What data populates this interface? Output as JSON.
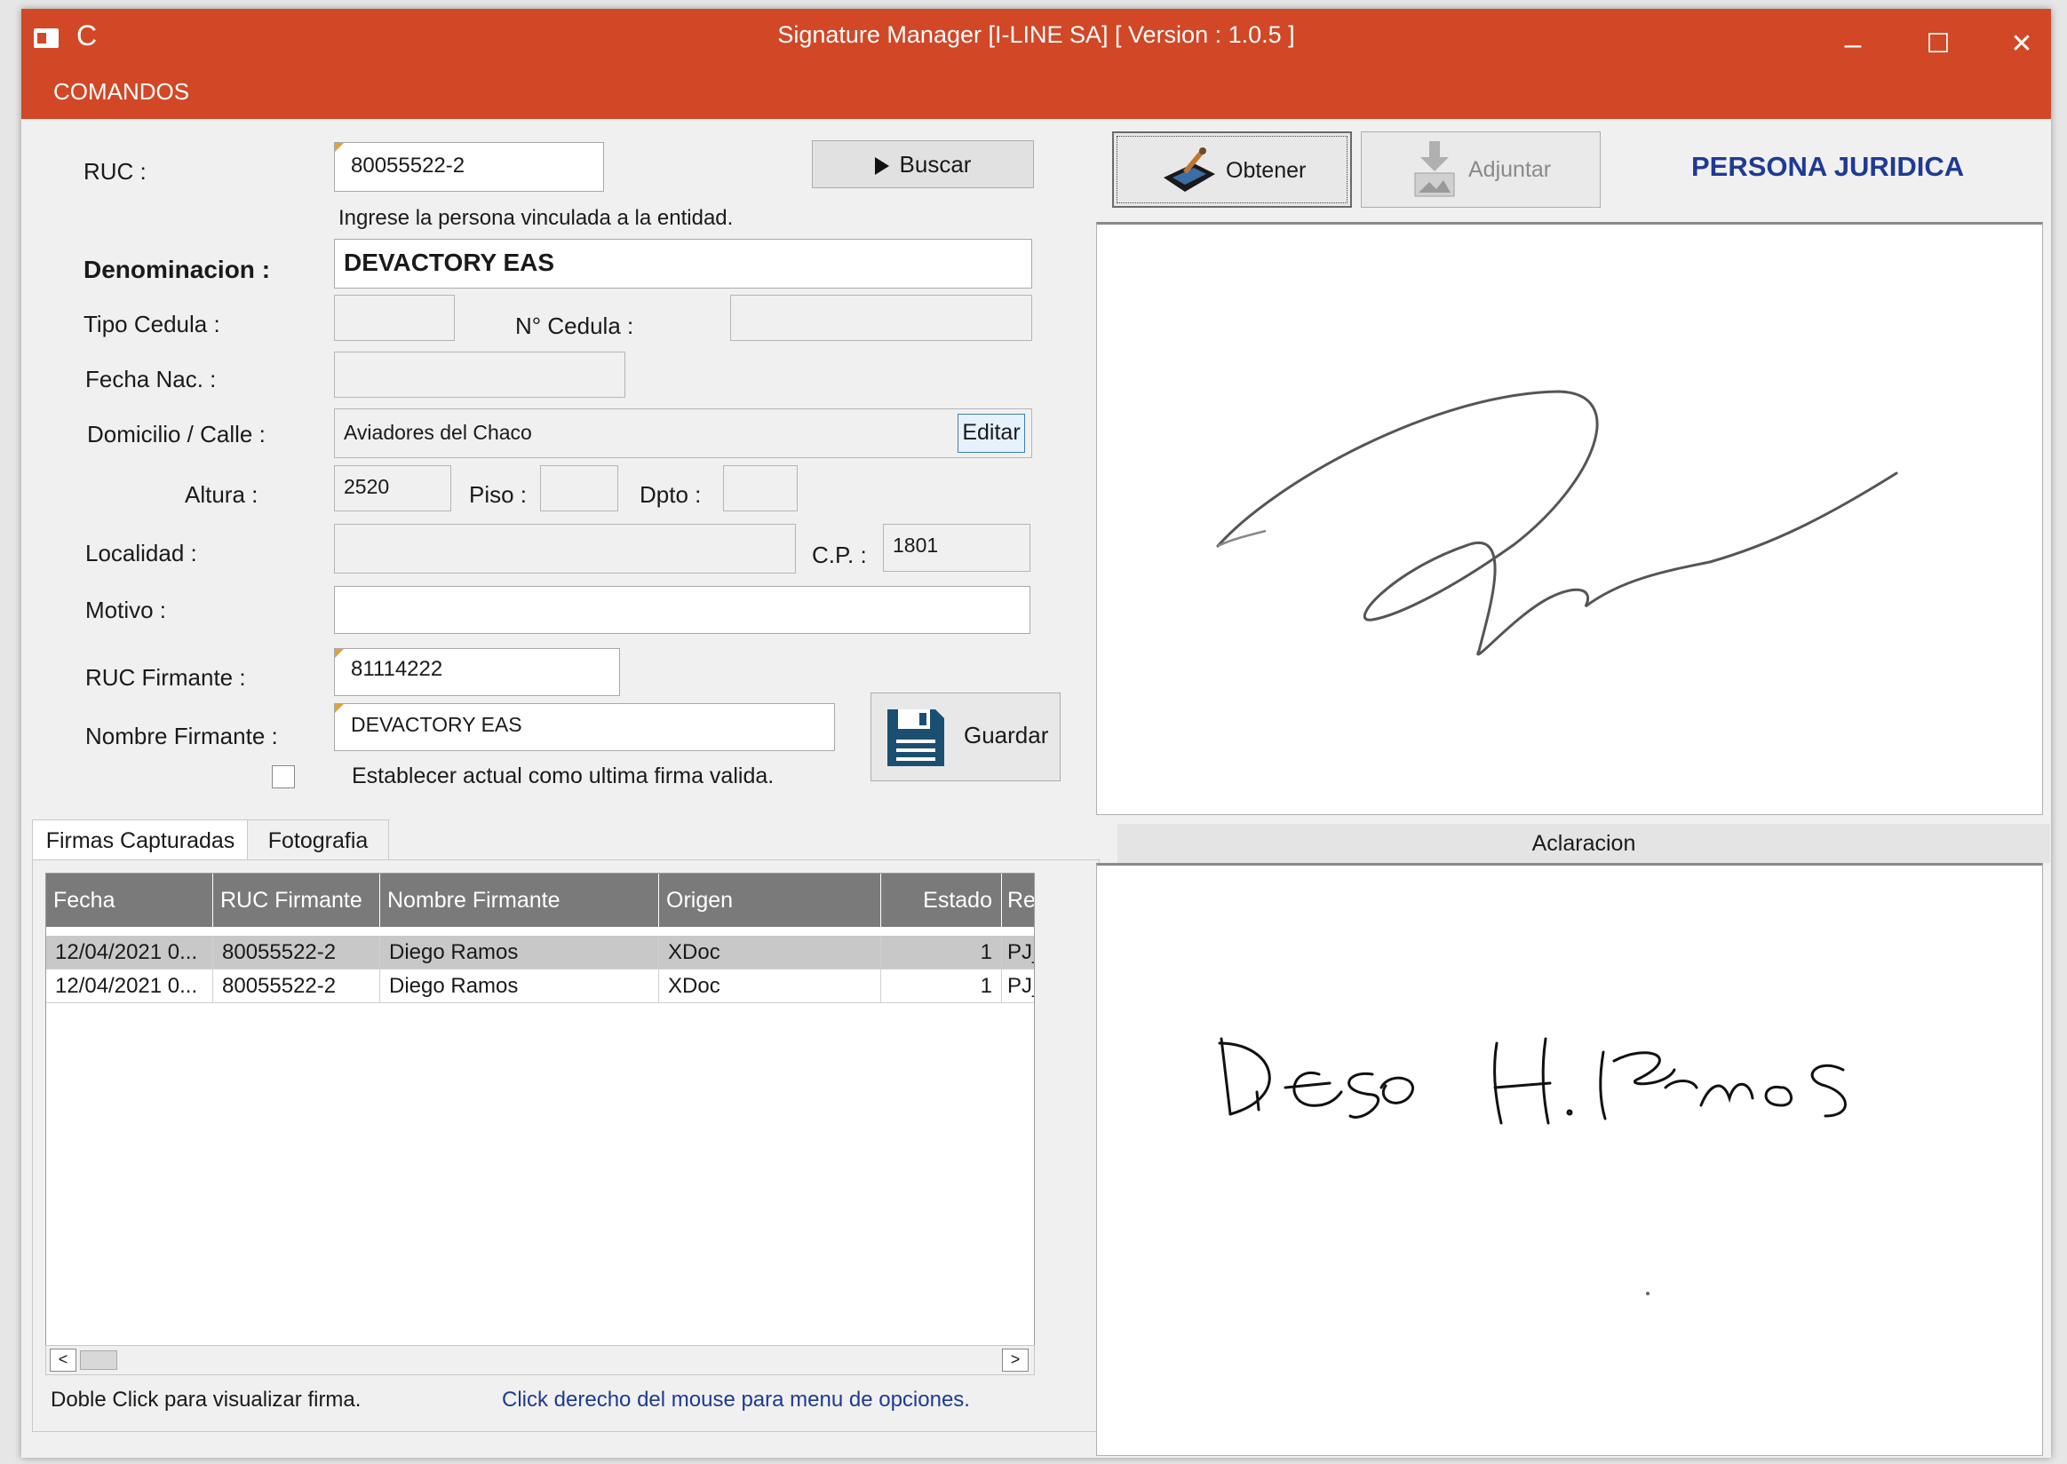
{
  "window": {
    "title": "Signature Manager  [I-LINE SA] [ Version : 1.0.5 ]",
    "minimize_glyph": "–",
    "maximize_glyph": "☐",
    "close_glyph": "✕",
    "accent_color": "#d24726"
  },
  "menu": {
    "comandos": "COMANDOS"
  },
  "form": {
    "ruc_label": "RUC :",
    "ruc_value": "80055522-2",
    "buscar_label": "Buscar",
    "hint": "Ingrese la persona vinculada a la entidad.",
    "denominacion_label": "Denominacion :",
    "denominacion_value": "DEVACTORY EAS",
    "tipo_cedula_label": "Tipo Cedula :",
    "tipo_cedula_value": "",
    "nro_cedula_label": "N° Cedula :",
    "nro_cedula_value": "",
    "fecha_nac_label": "Fecha Nac. :",
    "fecha_nac_value": "",
    "domicilio_label": "Domicilio / Calle :",
    "domicilio_value": "Aviadores del Chaco",
    "editar_label": "Editar",
    "altura_label": "Altura :",
    "altura_value": "2520",
    "piso_label": "Piso :",
    "piso_value": "",
    "dpto_label": "Dpto :",
    "dpto_value": "",
    "localidad_label": "Localidad :",
    "localidad_value": "",
    "cp_label": "C.P. :",
    "cp_value": "1801",
    "motivo_label": "Motivo :",
    "motivo_value": "",
    "ruc_firmante_label": "RUC Firmante :",
    "ruc_firmante_value": "81114222",
    "nombre_firmante_label": "Nombre Firmante :",
    "nombre_firmante_value": "DEVACTORY EAS",
    "guardar_label": "Guardar",
    "ultima_firma_label": "Establecer actual como ultima firma valida."
  },
  "tabs": [
    "Firmas Capturadas",
    "Fotografia"
  ],
  "grid": {
    "columns": [
      "Fecha",
      "RUC Firmante",
      "Nombre Firmante",
      "Origen",
      "Estado",
      "Re"
    ],
    "rows": [
      [
        "12/04/2021 0...",
        "80055522-2",
        "Diego Ramos",
        "XDoc",
        "1",
        "PJ_"
      ],
      [
        "12/04/2021 0...",
        "80055522-2",
        "Diego Ramos",
        "XDoc",
        "1",
        "PJ_"
      ]
    ],
    "scroll_left": "<",
    "scroll_right": ">"
  },
  "footer": {
    "doble_click": "Doble Click para visualizar firma.",
    "click_derecho": "Click derecho del mouse para menu de opciones."
  },
  "right": {
    "obtener_label": "Obtener",
    "adjuntar_label": "Adjuntar",
    "persona": "PERSONA JURIDICA",
    "aclaracion_label": "Aclaracion"
  },
  "colors": {
    "persona_text": "#1f3a93",
    "footer_link": "#1f3a93",
    "grid_header": "#7a7a7a"
  }
}
